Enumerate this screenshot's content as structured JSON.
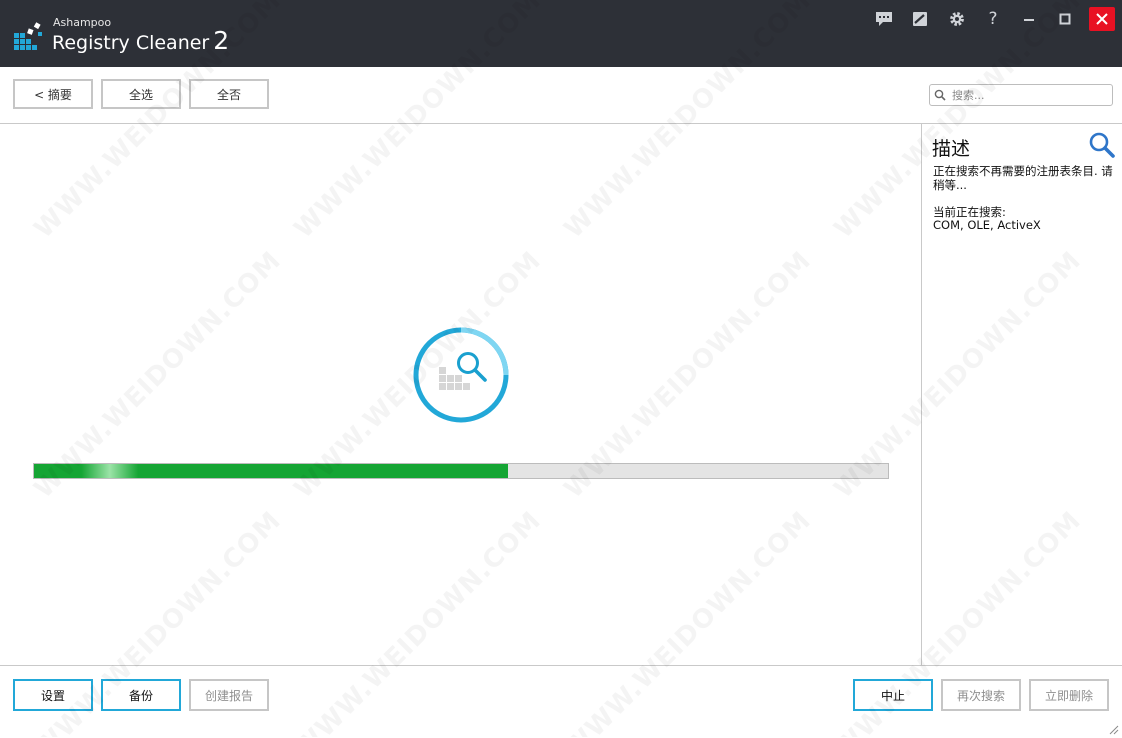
{
  "app": {
    "brand_small": "Ashampoo",
    "brand_name": "Registry Cleaner",
    "brand_version": "2"
  },
  "window_controls": [
    "feedback-icon",
    "skin-icon",
    "gear-icon",
    "help-icon",
    "minimize-icon",
    "maximize-icon",
    "close-icon"
  ],
  "window_controls_text": {
    "help": "?"
  },
  "toolbar": {
    "back_label": "< 摘要",
    "select_all_label": "全选",
    "select_none_label": "全否",
    "search_placeholder": "搜索..."
  },
  "scan": {
    "progress": 0.555,
    "progress_color": "#15a534",
    "accent_color": "#22a8d8"
  },
  "side": {
    "title": "描述",
    "text": "正在搜索不再需要的注册表条目. 请稍等...",
    "current_label": "当前正在搜索:",
    "current_value": "COM, OLE, ActiveX"
  },
  "bottom": {
    "settings_label": "设置",
    "backup_label": "备份",
    "create_report_label": "创建报告",
    "stop_label": "中止",
    "search_again_label": "再次搜索",
    "delete_now_label": "立即删除"
  },
  "watermark_text": "WWW.WEIDOWN.COM"
}
